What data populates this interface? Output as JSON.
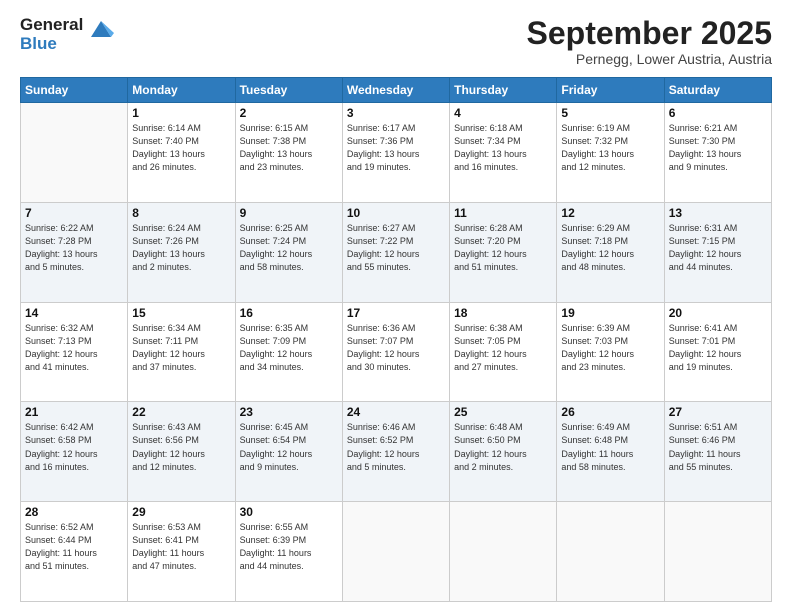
{
  "header": {
    "logo": {
      "line1": "General",
      "line2": "Blue"
    },
    "title": "September 2025",
    "location": "Pernegg, Lower Austria, Austria"
  },
  "days_of_week": [
    "Sunday",
    "Monday",
    "Tuesday",
    "Wednesday",
    "Thursday",
    "Friday",
    "Saturday"
  ],
  "weeks": [
    [
      {
        "day": "",
        "info": ""
      },
      {
        "day": "1",
        "info": "Sunrise: 6:14 AM\nSunset: 7:40 PM\nDaylight: 13 hours\nand 26 minutes."
      },
      {
        "day": "2",
        "info": "Sunrise: 6:15 AM\nSunset: 7:38 PM\nDaylight: 13 hours\nand 23 minutes."
      },
      {
        "day": "3",
        "info": "Sunrise: 6:17 AM\nSunset: 7:36 PM\nDaylight: 13 hours\nand 19 minutes."
      },
      {
        "day": "4",
        "info": "Sunrise: 6:18 AM\nSunset: 7:34 PM\nDaylight: 13 hours\nand 16 minutes."
      },
      {
        "day": "5",
        "info": "Sunrise: 6:19 AM\nSunset: 7:32 PM\nDaylight: 13 hours\nand 12 minutes."
      },
      {
        "day": "6",
        "info": "Sunrise: 6:21 AM\nSunset: 7:30 PM\nDaylight: 13 hours\nand 9 minutes."
      }
    ],
    [
      {
        "day": "7",
        "info": "Sunrise: 6:22 AM\nSunset: 7:28 PM\nDaylight: 13 hours\nand 5 minutes."
      },
      {
        "day": "8",
        "info": "Sunrise: 6:24 AM\nSunset: 7:26 PM\nDaylight: 13 hours\nand 2 minutes."
      },
      {
        "day": "9",
        "info": "Sunrise: 6:25 AM\nSunset: 7:24 PM\nDaylight: 12 hours\nand 58 minutes."
      },
      {
        "day": "10",
        "info": "Sunrise: 6:27 AM\nSunset: 7:22 PM\nDaylight: 12 hours\nand 55 minutes."
      },
      {
        "day": "11",
        "info": "Sunrise: 6:28 AM\nSunset: 7:20 PM\nDaylight: 12 hours\nand 51 minutes."
      },
      {
        "day": "12",
        "info": "Sunrise: 6:29 AM\nSunset: 7:18 PM\nDaylight: 12 hours\nand 48 minutes."
      },
      {
        "day": "13",
        "info": "Sunrise: 6:31 AM\nSunset: 7:15 PM\nDaylight: 12 hours\nand 44 minutes."
      }
    ],
    [
      {
        "day": "14",
        "info": "Sunrise: 6:32 AM\nSunset: 7:13 PM\nDaylight: 12 hours\nand 41 minutes."
      },
      {
        "day": "15",
        "info": "Sunrise: 6:34 AM\nSunset: 7:11 PM\nDaylight: 12 hours\nand 37 minutes."
      },
      {
        "day": "16",
        "info": "Sunrise: 6:35 AM\nSunset: 7:09 PM\nDaylight: 12 hours\nand 34 minutes."
      },
      {
        "day": "17",
        "info": "Sunrise: 6:36 AM\nSunset: 7:07 PM\nDaylight: 12 hours\nand 30 minutes."
      },
      {
        "day": "18",
        "info": "Sunrise: 6:38 AM\nSunset: 7:05 PM\nDaylight: 12 hours\nand 27 minutes."
      },
      {
        "day": "19",
        "info": "Sunrise: 6:39 AM\nSunset: 7:03 PM\nDaylight: 12 hours\nand 23 minutes."
      },
      {
        "day": "20",
        "info": "Sunrise: 6:41 AM\nSunset: 7:01 PM\nDaylight: 12 hours\nand 19 minutes."
      }
    ],
    [
      {
        "day": "21",
        "info": "Sunrise: 6:42 AM\nSunset: 6:58 PM\nDaylight: 12 hours\nand 16 minutes."
      },
      {
        "day": "22",
        "info": "Sunrise: 6:43 AM\nSunset: 6:56 PM\nDaylight: 12 hours\nand 12 minutes."
      },
      {
        "day": "23",
        "info": "Sunrise: 6:45 AM\nSunset: 6:54 PM\nDaylight: 12 hours\nand 9 minutes."
      },
      {
        "day": "24",
        "info": "Sunrise: 6:46 AM\nSunset: 6:52 PM\nDaylight: 12 hours\nand 5 minutes."
      },
      {
        "day": "25",
        "info": "Sunrise: 6:48 AM\nSunset: 6:50 PM\nDaylight: 12 hours\nand 2 minutes."
      },
      {
        "day": "26",
        "info": "Sunrise: 6:49 AM\nSunset: 6:48 PM\nDaylight: 11 hours\nand 58 minutes."
      },
      {
        "day": "27",
        "info": "Sunrise: 6:51 AM\nSunset: 6:46 PM\nDaylight: 11 hours\nand 55 minutes."
      }
    ],
    [
      {
        "day": "28",
        "info": "Sunrise: 6:52 AM\nSunset: 6:44 PM\nDaylight: 11 hours\nand 51 minutes."
      },
      {
        "day": "29",
        "info": "Sunrise: 6:53 AM\nSunset: 6:41 PM\nDaylight: 11 hours\nand 47 minutes."
      },
      {
        "day": "30",
        "info": "Sunrise: 6:55 AM\nSunset: 6:39 PM\nDaylight: 11 hours\nand 44 minutes."
      },
      {
        "day": "",
        "info": ""
      },
      {
        "day": "",
        "info": ""
      },
      {
        "day": "",
        "info": ""
      },
      {
        "day": "",
        "info": ""
      }
    ]
  ]
}
